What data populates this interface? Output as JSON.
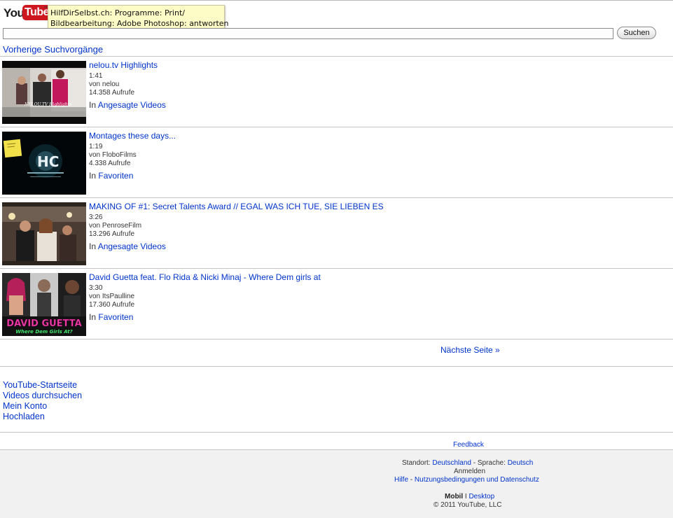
{
  "header": {
    "logo_you": "You",
    "logo_tube": "Tube",
    "logo_tm": "™",
    "tooltip_line1": "HilfDirSelbst.ch: Programme: Print/",
    "tooltip_line2": "Bildbearbeitung: Adobe Photoshop: antworten"
  },
  "search": {
    "value": "",
    "button_label": "Suchen",
    "previous_searches": "Vorherige Suchvorgänge"
  },
  "videos": [
    {
      "title": "nelou.tv Highlights",
      "duration": "1:41",
      "by": "von nelou",
      "views": "14.358 Aufrufe",
      "in_prefix": "In",
      "in_link": "Angesagte Videos",
      "thumb_caption": "NELOU.TV Highlights"
    },
    {
      "title": "Montages these days...",
      "duration": "1:19",
      "by": "von FloboFilms",
      "views": "4.338 Aufrufe",
      "in_prefix": "In",
      "in_link": "Favoriten",
      "thumb_caption": "HC"
    },
    {
      "title": "MAKING OF #1: Secret Talents Award // EGAL WAS ICH TUE, SIE LIEBEN ES",
      "duration": "3:26",
      "by": "von PenroseFilm",
      "views": "13.296 Aufrufe",
      "in_prefix": "In",
      "in_link": "Angesagte Videos",
      "thumb_caption": ""
    },
    {
      "title": "David Guetta feat. Flo Rida & Nicki Minaj - Where Dem girls at",
      "duration": "3:30",
      "by": "von ItsPaulline",
      "views": "17.360 Aufrufe",
      "in_prefix": "In",
      "in_link": "Favoriten",
      "thumb_caption": "DAVID GUETTA",
      "thumb_caption2": "Where Dem Girls At?"
    }
  ],
  "pagination": {
    "next": "Nächste Seite »"
  },
  "nav": {
    "home": "YouTube-Startseite",
    "browse": "Videos durchsuchen",
    "account": "Mein Konto",
    "upload": "Hochladen"
  },
  "footer": {
    "feedback": "Feedback",
    "location_label": "Standort:",
    "location_value": "Deutschland",
    "sep_dash": "-",
    "language_label": "Sprache:",
    "language_value": "Deutsch",
    "signin": "Anmelden",
    "help": "Hilfe",
    "terms": "Nutzungsbedingungen und Datenschutz",
    "mobile": "Mobil",
    "pipe": "I",
    "desktop": "Desktop",
    "copyright": "© 2011 YouTube, LLC"
  },
  "colors": {
    "link": "#0033cc",
    "logo_red": "#cc181e",
    "tooltip_bg": "#fdfbc6",
    "footer_bg": "#f1f1f1"
  }
}
